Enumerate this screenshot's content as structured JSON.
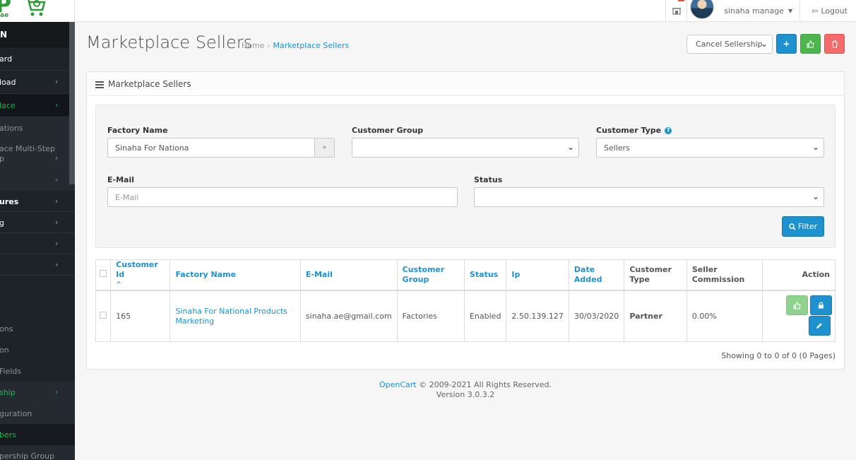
{
  "header": {
    "logo_letter": "P",
    "logo_sub": "ae",
    "user_name": "sinaha manage",
    "logout_label": "Logout"
  },
  "sidebar": {
    "head": "N",
    "items": [
      {
        "label": "ard",
        "chev": ""
      },
      {
        "label": "load",
        "chev": "›"
      },
      {
        "label": "lace",
        "chev": "›"
      },
      {
        "label": "ations",
        "chev": ""
      },
      {
        "label": "ace Multi-Step",
        "label2": "p",
        "chev": "›"
      },
      {
        "label": "",
        "chev": "›"
      },
      {
        "label": "ures",
        "chev": "›"
      },
      {
        "label": "g",
        "chev": "›"
      },
      {
        "label": "",
        "chev": "›"
      },
      {
        "label": "",
        "chev": "›"
      },
      {
        "label": "ons",
        "chev": ""
      },
      {
        "label": "on",
        "chev": ""
      },
      {
        "label": "Fields",
        "chev": ""
      },
      {
        "label": "ship",
        "chev": "›"
      },
      {
        "label": "guration",
        "chev": ""
      },
      {
        "label": "bers",
        "chev": ""
      },
      {
        "label": "pership Group",
        "chev": ""
      }
    ]
  },
  "page": {
    "title": "Marketplace Sellers",
    "breadcrumb": {
      "home": "Home",
      "current": "Marketplace Sellers"
    },
    "sellership_select": "Cancel Sellership",
    "panel_title": "Marketplace Sellers"
  },
  "filter": {
    "factory_name_label": "Factory Name",
    "factory_name_value": "Sinaha For Nationa",
    "customer_group_label": "Customer Group",
    "customer_group_value": "",
    "customer_type_label": "Customer Type",
    "customer_type_value": "Sellers",
    "email_label": "E-Mail",
    "email_placeholder": "E-Mail",
    "status_label": "Status",
    "status_value": "",
    "filter_button": "Filter"
  },
  "table": {
    "headers": {
      "customer_id": "Customer Id",
      "factory_name": "Factory Name",
      "email": "E-Mail",
      "customer_group_1": "Customer",
      "customer_group_2": "Group",
      "status": "Status",
      "ip": "Ip",
      "date_added_1": "Date",
      "date_added_2": "Added",
      "customer_type_1": "Customer",
      "customer_type_2": "Type",
      "seller_commission_1": "Seller",
      "seller_commission_2": "Commission",
      "action": "Action"
    },
    "rows": [
      {
        "customer_id": "165",
        "factory_name_1": "Sinaha For National Products",
        "factory_name_2": "Marketing",
        "email": "sinaha.ae@gmail.com",
        "customer_group": "Factories",
        "status": "Enabled",
        "ip": "2.50.139.127",
        "date_added": "30/03/2020",
        "customer_type": "Partner",
        "seller_commission": "0.00%"
      }
    ],
    "showing": "Showing 0 to 0 of 0 (0 Pages)"
  },
  "footer": {
    "brand": "OpenCart",
    "copyright": " © 2009-2021 All Rights Reserved.",
    "version": "Version 3.0.3.2"
  },
  "colors": {
    "primary": "#1e91cf",
    "success": "#4cb64c",
    "danger": "#f56b6b",
    "sidebar_bg": "#1e2328",
    "sidebar_active": "#1fb45b"
  },
  "icons": {
    "store": "store-icon",
    "logout": "sign-out-icon",
    "list": "list-icon",
    "add": "plus-icon",
    "approve": "thumbs-up-icon",
    "delete": "trash-icon",
    "lock": "lock-icon",
    "edit": "pencil-icon",
    "search": "search-icon",
    "help": "question-circle-icon"
  }
}
